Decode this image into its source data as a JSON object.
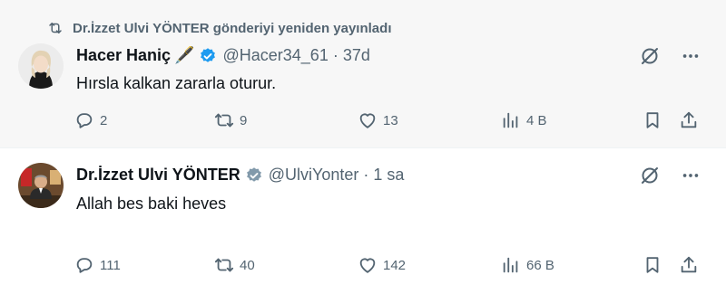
{
  "repost_banner": {
    "text": "Dr.İzzet Ulvi YÖNTER gönderiyi yeniden yayınladı",
    "icon": "repost-icon"
  },
  "tweets": [
    {
      "author": "Hacer Haniç",
      "name_emoji": "🖋️",
      "handle": "@Hacer34_61",
      "separator": "·",
      "time": "37d",
      "text": "Hırsla kalkan zararla oturur.",
      "replies": "2",
      "reposts": "9",
      "likes": "13",
      "views": "4 B"
    },
    {
      "author": "Dr.İzzet Ulvi YÖNTER",
      "handle": "@UlviYonter",
      "separator": "·",
      "time": "1 sa",
      "text": "Allah bes baki heves",
      "replies": "111",
      "reposts": "40",
      "likes": "142",
      "views": "66 B"
    }
  ],
  "colors": {
    "verified_blue": "#1d9bf0",
    "verified_gray": "#829aab",
    "muted": "#536471",
    "text": "#0f1419"
  }
}
